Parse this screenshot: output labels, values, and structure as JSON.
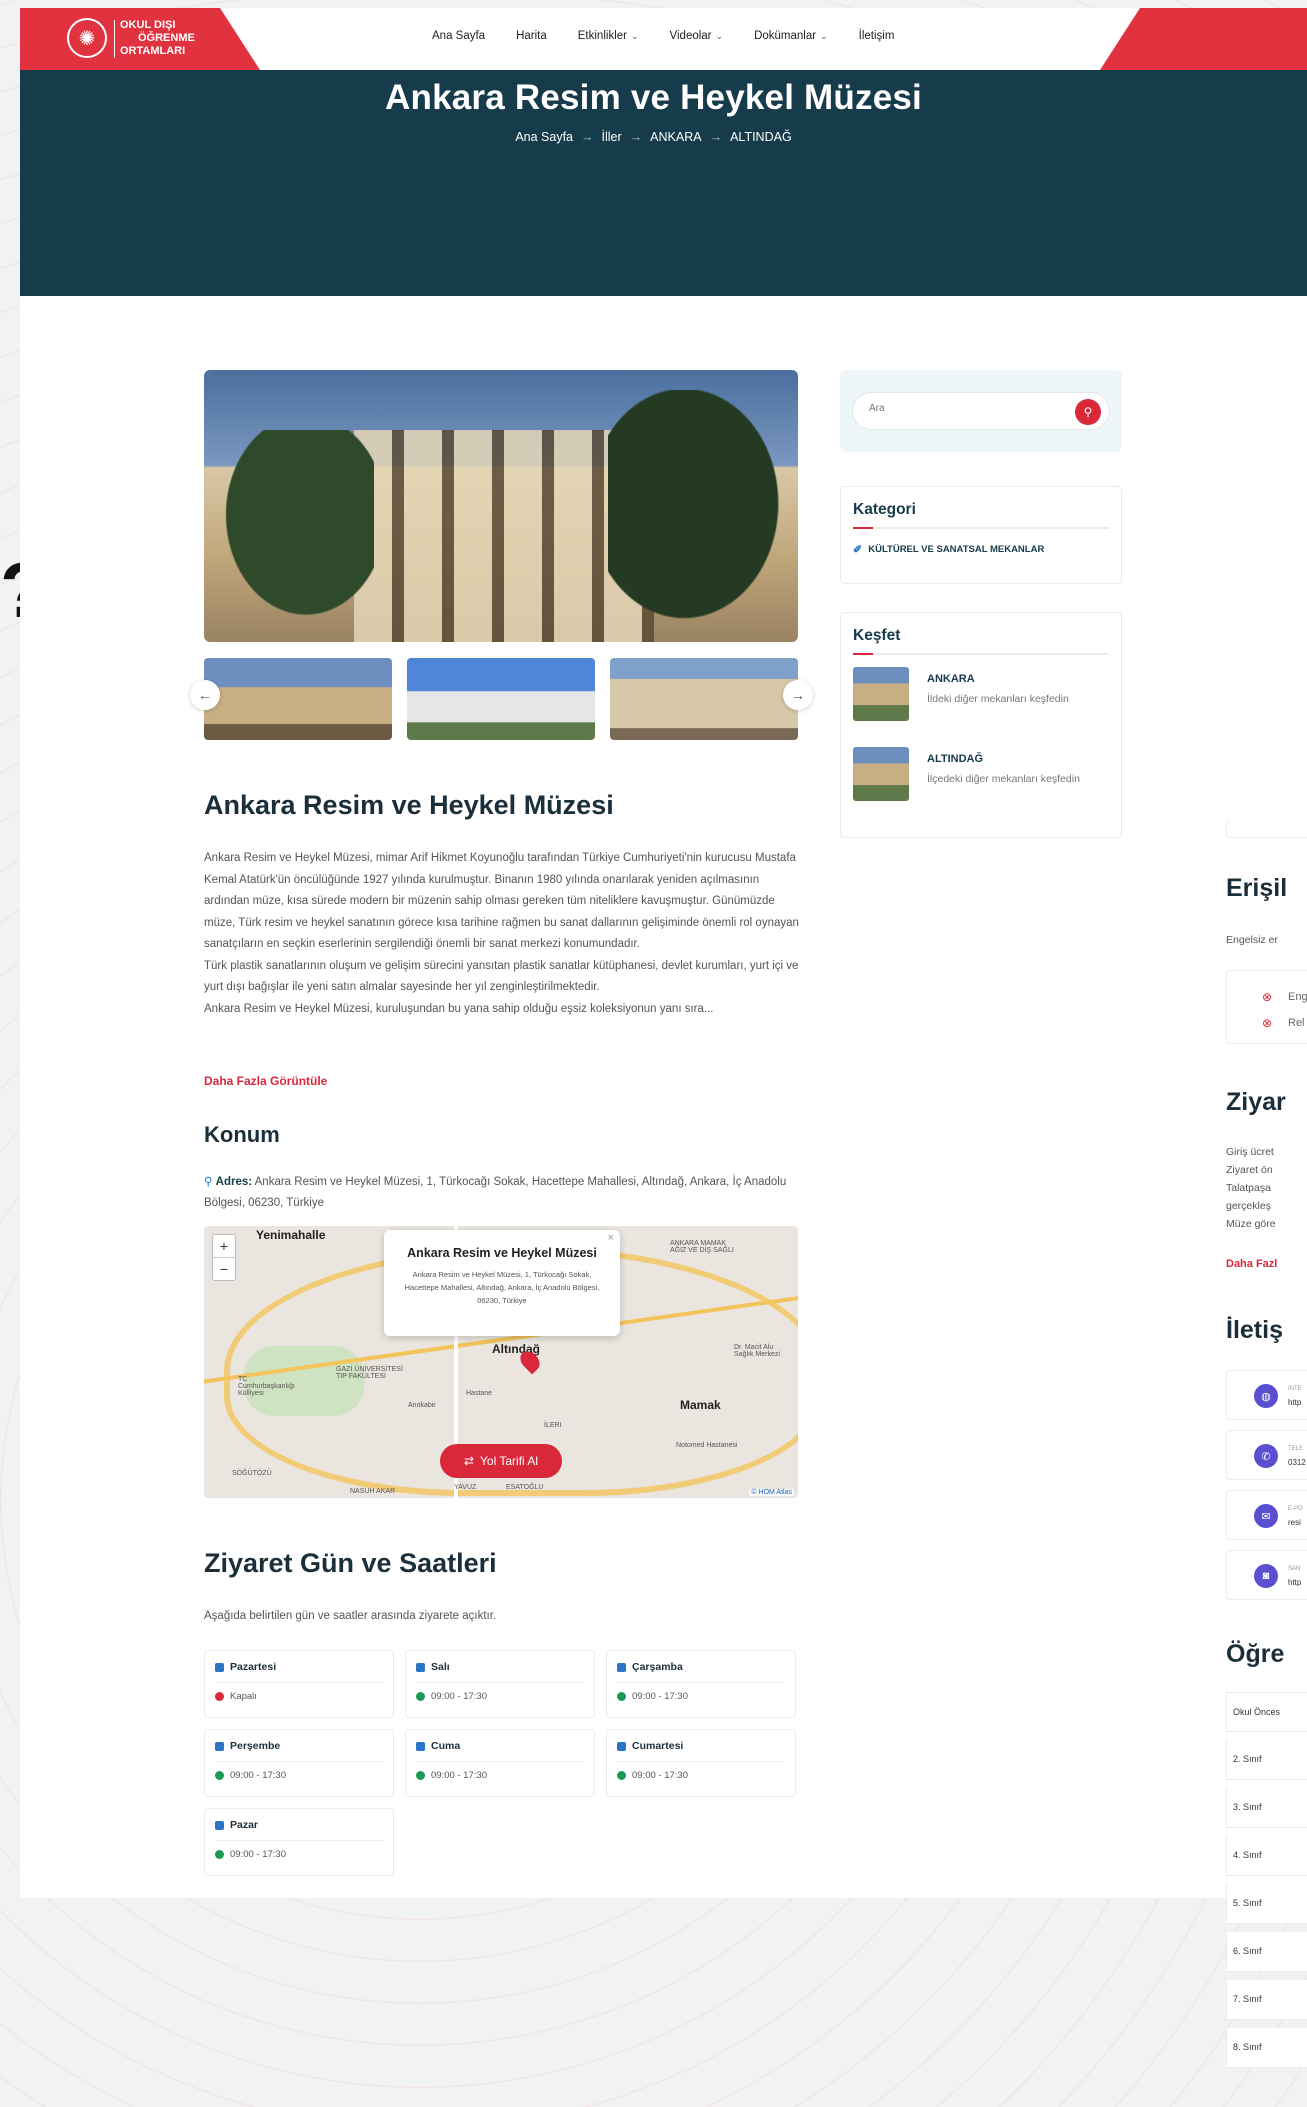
{
  "header": {
    "logo_lines": [
      "OKUL DIŞI",
      "ÖĞRENME",
      "ORTAMLARI"
    ],
    "nav": [
      {
        "label": "Ana Sayfa",
        "dropdown": false
      },
      {
        "label": "Harita",
        "dropdown": false
      },
      {
        "label": "Etkinlikler",
        "dropdown": true
      },
      {
        "label": "Videolar",
        "dropdown": true
      },
      {
        "label": "Dokümanlar",
        "dropdown": true
      },
      {
        "label": "İletişim",
        "dropdown": false
      }
    ]
  },
  "hero": {
    "title": "Ankara Resim ve Heykel Müzesi",
    "breadcrumb": [
      "Ana Sayfa",
      "İller",
      "ANKARA",
      "ALTINDAĞ"
    ]
  },
  "museum": {
    "title": "Ankara Resim ve Heykel Müzesi",
    "paragraphs": [
      "Ankara Resim ve Heykel Müzesi, mimar Arif Hikmet Koyunoğlu tarafından Türkiye Cumhuriyeti'nin kurucusu Mustafa Kemal Atatürk'ün öncülüğünde 1927 yılında kurulmuştur. Binanın 1980 yılında onarılarak yeniden açılmasının ardından müze, kısa sürede modern bir müzenin sahip olması gereken tüm niteliklere kavuşmuştur. Günümüzde müze, Türk resim ve heykel sanatının görece kısa tarihine rağmen bu sanat dallarının gelişiminde önemli rol oynayan sanatçıların en seçkin eserlerinin sergilendiği önemli bir sanat merkezi konumundadır.",
      "Türk plastik sanatlarının oluşum ve gelişim sürecini yansıtan plastik sanatlar kütüphanesi, devlet kurumları, yurt içi ve yurt dışı bağışlar ile yeni satın almalar sayesinde her yıl zenginleştirilmektedir.",
      "Ankara Resim ve Heykel Müzesi, kuruluşundan bu yana sahip olduğu eşsiz koleksiyonun yanı sıra..."
    ],
    "more_label": "Daha Fazla Görüntüle"
  },
  "location": {
    "title": "Konum",
    "address_label": "Adres:",
    "address": "Ankara Resim ve Heykel Müzesi, 1, Türkocağı Sokak, Hacettepe Mahallesi, Altındağ, Ankara, İç Anadolu Bölgesi, 06230, Türkiye",
    "map": {
      "popup_title": "Ankara Resim ve Heykel Müzesi",
      "popup_address": "Ankara Resim ve Heykel Müzesi, 1, Türkocağı Sokak, Hacettepe Mahallesi, Altındağ, Ankara, İç Anadolu Bölgesi, 06230, Türkiye",
      "labels": [
        "Yenimahalle",
        "Altındağ",
        "Mamak"
      ],
      "small_labels": [
        "TC Cumhurbaşkanlığı Külliyesi",
        "GAZİ ÜNİVERSİTESİ TIP FAKÜLTESİ",
        "Anıtkabir",
        "Hastane",
        "İLERI",
        "SÖĞÜTÖZÜ",
        "YAVUZ",
        "ESATOĞLU",
        "NASUH AKAR",
        "Notomed Hastanesi",
        "Dr. Macit Alu Sağlık Merkezi",
        "ANKARA MAMAK AĞIZ VE DİŞ SAĞLI"
      ],
      "route_label": "Yol Tarifi Al",
      "attribution": "© HOM Atlas"
    }
  },
  "visit": {
    "title": "Ziyaret Gün ve Saatleri",
    "subtitle": "Aşağıda belirtilen gün ve saatler arasında ziyarete açıktır.",
    "days": [
      {
        "name": "Pazartesi",
        "time": "Kapalı",
        "open": false
      },
      {
        "name": "Salı",
        "time": "09:00 - 17:30",
        "open": true
      },
      {
        "name": "Çarşamba",
        "time": "09:00 - 17:30",
        "open": true
      },
      {
        "name": "Perşembe",
        "time": "09:00 - 17:30",
        "open": true
      },
      {
        "name": "Cuma",
        "time": "09:00 - 17:30",
        "open": true
      },
      {
        "name": "Cumartesi",
        "time": "09:00 - 17:30",
        "open": true
      },
      {
        "name": "Pazar",
        "time": "09:00 - 17:30",
        "open": true
      }
    ]
  },
  "sidebar": {
    "search_placeholder": "Ara",
    "category": {
      "title": "Kategori",
      "item": "KÜLTÜREL VE SANATSAL MEKANLAR"
    },
    "explore": {
      "title": "Keşfet",
      "items": [
        {
          "name": "ANKARA",
          "sub": "İldeki diğer mekanları keşfedin"
        },
        {
          "name": "ALTINDAĞ",
          "sub": "İlçedeki diğer mekanları keşfedin"
        }
      ]
    }
  },
  "right_column": {
    "access_title": "Erişil",
    "access_text": "Engelsiz er",
    "access_items": [
      "Eng",
      "Rel"
    ],
    "visit_title": "Ziyar",
    "visit_lines": [
      "Giriş ücret",
      "Ziyaret ön",
      "Talatpaşa",
      "gerçekleş",
      "Müze göre"
    ],
    "visit_more": "Daha Fazl",
    "contact_title": "İletiş",
    "contacts": [
      {
        "label": "INTE",
        "value": "http"
      },
      {
        "label": "TELE",
        "value": "0312"
      },
      {
        "label": "E-PO",
        "value": "resi"
      },
      {
        "label": "SAN",
        "value": "http"
      }
    ],
    "grades_title": "Öğre",
    "grades": [
      "Okul Önces",
      "2. Sınıf",
      "3. Sınıf",
      "4. Sınıf",
      "5. Sınıf",
      "6. Sınıf",
      "7. Sınıf",
      "8. Sınıf"
    ]
  },
  "colors": {
    "brand_red": "#e0323f",
    "hero_bg": "#163b4a",
    "open_green": "#1a9a55",
    "closed_red": "#d8283a"
  }
}
